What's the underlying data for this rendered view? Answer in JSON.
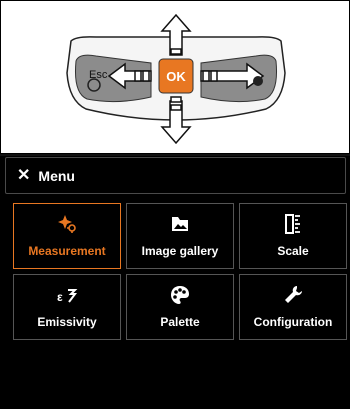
{
  "keypad": {
    "esc_label": "Esc",
    "ok_label": "OK"
  },
  "menu": {
    "close_glyph": "✕",
    "title": "Menu"
  },
  "tiles": [
    {
      "label": "Measurement",
      "icon": "measurement-icon",
      "active": true
    },
    {
      "label": "Image gallery",
      "icon": "image-gallery-icon",
      "active": false
    },
    {
      "label": "Scale",
      "icon": "scale-icon",
      "active": false
    },
    {
      "label": "Emissivity",
      "icon": "emissivity-icon",
      "active": false
    },
    {
      "label": "Palette",
      "icon": "palette-icon",
      "active": false
    },
    {
      "label": "Configuration",
      "icon": "wrench-icon",
      "active": false
    }
  ],
  "colors": {
    "accent": "#e87722",
    "background": "#000000",
    "text": "#ffffff",
    "tile_border": "#555555"
  }
}
